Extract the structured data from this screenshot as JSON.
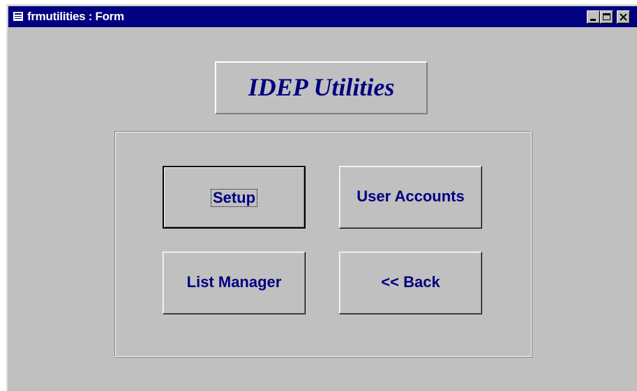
{
  "window": {
    "title": "frmutilities : Form",
    "controls": {
      "minimize": "minimize",
      "maximize": "maximize",
      "close": "close"
    }
  },
  "form": {
    "heading": "IDEP Utilities",
    "buttons": {
      "setup": "Setup",
      "user_accounts": "User Accounts",
      "list_manager": "List Manager",
      "back": "<< Back"
    },
    "focused_button": "Setup"
  },
  "colors": {
    "titlebar": "#000080",
    "face": "#c0c0c0",
    "label_text": "#000080"
  },
  "icons": {
    "title_icon": "form-icon",
    "minimize": "minimize-icon",
    "maximize": "maximize-icon",
    "close": "close-icon"
  }
}
